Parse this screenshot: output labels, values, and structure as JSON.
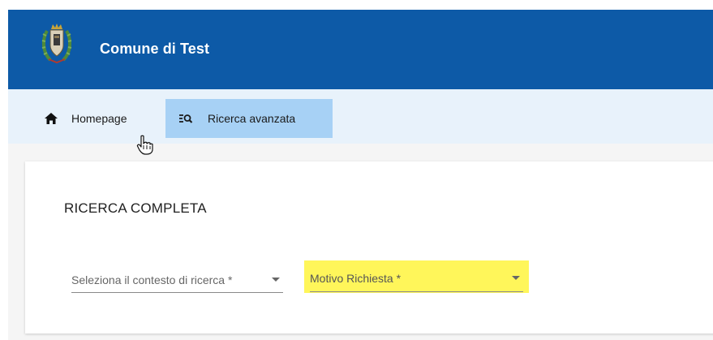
{
  "header": {
    "title": "Comune di Test",
    "background_color": "#0d5aa7",
    "crest_icon": "municipal-crest-icon"
  },
  "nav": {
    "items": [
      {
        "label": "Homepage",
        "icon": "home-icon",
        "active": false
      },
      {
        "label": "Ricerca avanzata",
        "icon": "advanced-search-icon",
        "active": true
      }
    ],
    "background_color": "#e8f2fb",
    "active_color": "#a7d1f5"
  },
  "main": {
    "title": "RICERCA COMPLETA",
    "fields": [
      {
        "label": "Seleziona il contesto di ricerca *",
        "highlighted": false
      },
      {
        "label": "Motivo Richiesta *",
        "highlighted": true
      }
    ],
    "highlight_color": "#fff65a"
  }
}
